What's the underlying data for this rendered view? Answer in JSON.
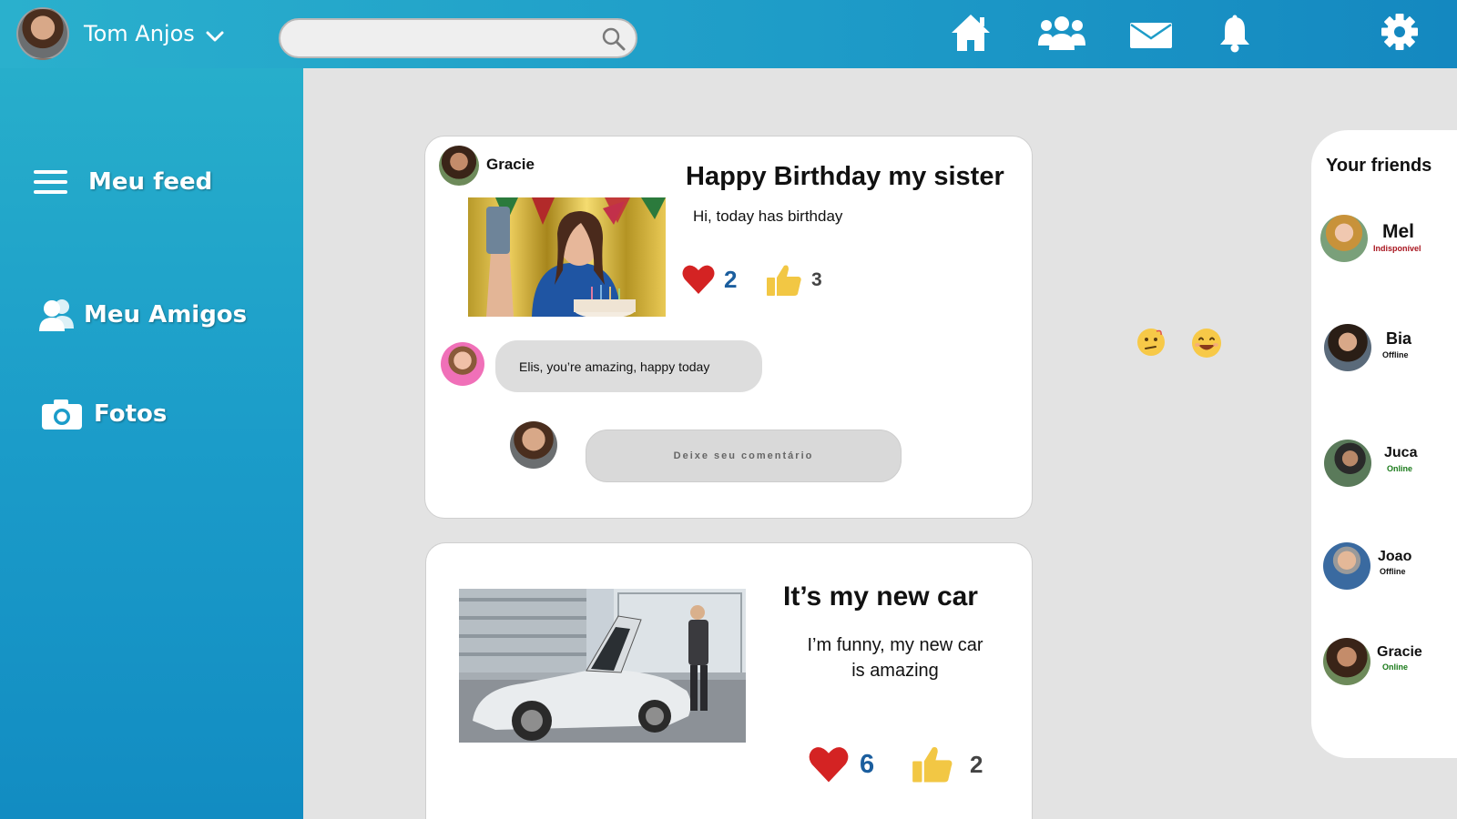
{
  "user": {
    "name": "Tom Anjos"
  },
  "search": {
    "placeholder": "",
    "value": ""
  },
  "sidebar": {
    "items": [
      {
        "label": "Meu feed",
        "icon": "menu-icon"
      },
      {
        "label": "Meu Amigos",
        "icon": "friends-icon"
      },
      {
        "label": "Fotos",
        "icon": "camera-icon"
      }
    ]
  },
  "nav": [
    "home-icon",
    "groups-icon",
    "mail-icon",
    "bell-icon",
    "gear-icon"
  ],
  "posts": [
    {
      "author": "Gracie",
      "title": "Happy Birthday my sister",
      "text": "Hi, today has birthday",
      "hearts": "2",
      "likes": "3",
      "comment": "Elis, you’re amazing, happy today",
      "comment_placeholder": "Deixe seu comentário"
    },
    {
      "title": "It’s my new car",
      "text_line1": "I’m funny, my new car",
      "text_line2": "is amazing",
      "hearts": "6",
      "likes": "2"
    }
  ],
  "emojis": [
    "confused-emoji",
    "smile-emoji"
  ],
  "friends_panel": {
    "title": "Your friends",
    "friends": [
      {
        "name": "Mel",
        "status": "Indisponível",
        "status_color": "#a8141e"
      },
      {
        "name": "Bia",
        "status": "Offline",
        "status_color": "#111111"
      },
      {
        "name": "Juca",
        "status": "Online",
        "status_color": "#1a7a1a"
      },
      {
        "name": "Joao",
        "status": "Offline",
        "status_color": "#111111"
      },
      {
        "name": "Gracie",
        "status": "Online",
        "status_color": "#1a7a1a"
      }
    ]
  },
  "colors": {
    "topbar": "#1e9cc8",
    "sidebar": "#1b9cc9",
    "background": "#e3e3e3",
    "heart": "#d42323",
    "like": "#f2c744",
    "count_blue": "#1b5e9e"
  }
}
